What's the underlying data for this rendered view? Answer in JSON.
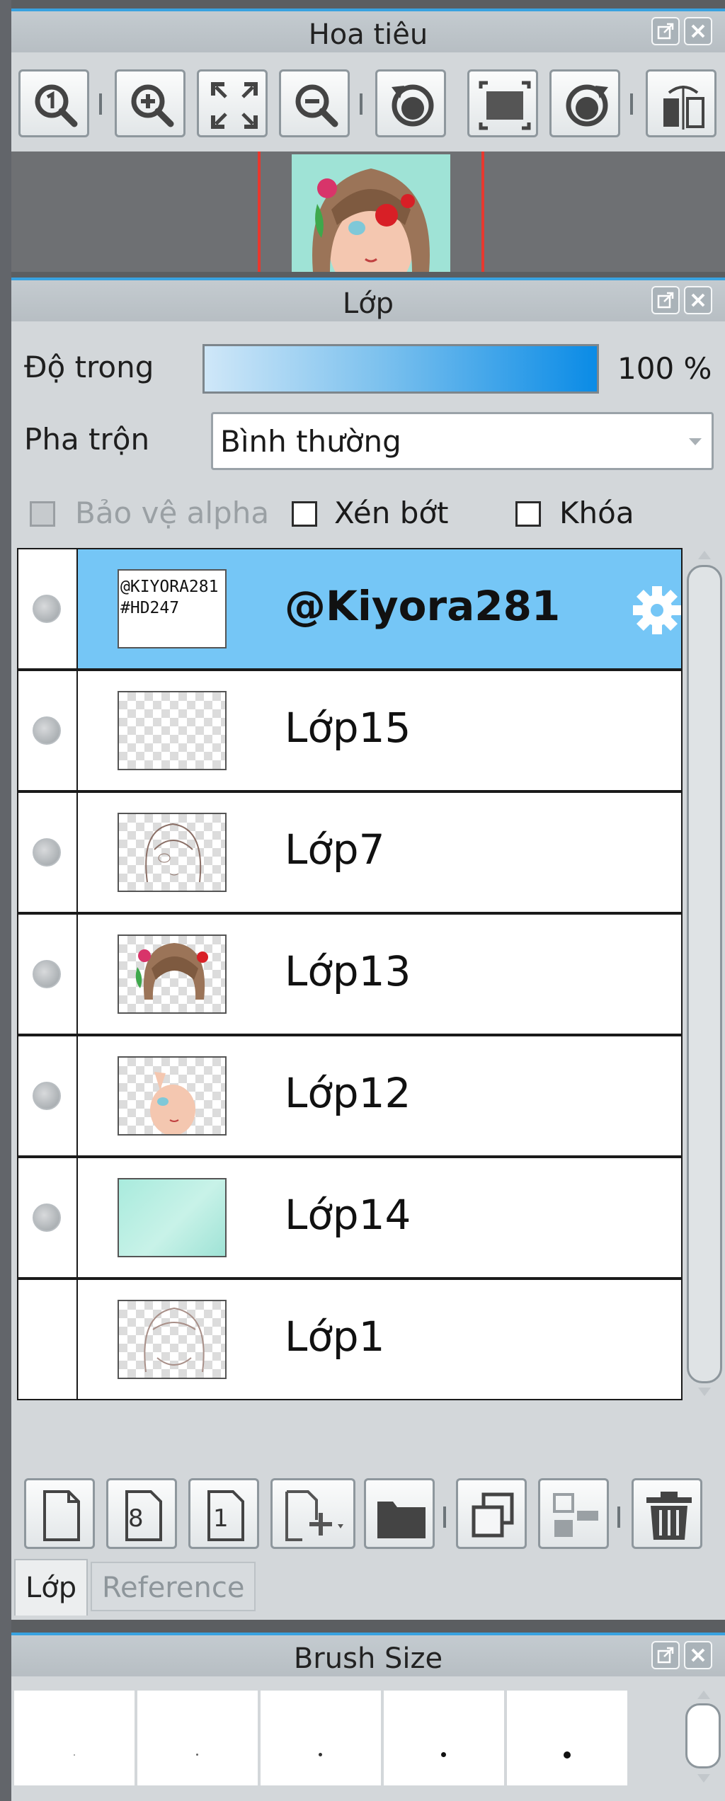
{
  "navigator": {
    "title": "Hoa tiêu",
    "tools": [
      "zoom-actual-icon",
      "zoom-in-icon",
      "fit-window-icon",
      "zoom-out-icon",
      "rotate-left-icon",
      "rotate-reset-icon",
      "rotate-right-icon",
      "flip-horizontal-icon"
    ]
  },
  "layers_panel": {
    "title": "Lớp",
    "opacity_label": "Độ trong",
    "opacity_value": "100 %",
    "opacity_level": 1.0,
    "blend_label": "Pha trộn",
    "blend_value": "Bình thường",
    "protect_alpha_label": "Bảo vệ alpha",
    "clipping_label": "Xén bớt",
    "lock_label": "Khóa",
    "layers": [
      {
        "name": "@Kiyora281",
        "thumb_text_1": "@KIYORA281",
        "thumb_text_2": "#HD247",
        "selected": true
      },
      {
        "name": "Lớp15"
      },
      {
        "name": "Lớp7"
      },
      {
        "name": "Lớp13"
      },
      {
        "name": "Lớp12"
      },
      {
        "name": "Lớp14"
      },
      {
        "name": "Lớp1"
      }
    ],
    "toolbar": {
      "new_8bit_label": "8",
      "new_1bit_label": "1"
    },
    "tabs": {
      "active": "Lớp",
      "inactive": "Reference"
    }
  },
  "brush_size": {
    "title": "Brush Size"
  },
  "colors": {
    "accent": "#39a2e0",
    "selected_row": "#75c6f6",
    "panel_bg": "#d3d7da"
  }
}
